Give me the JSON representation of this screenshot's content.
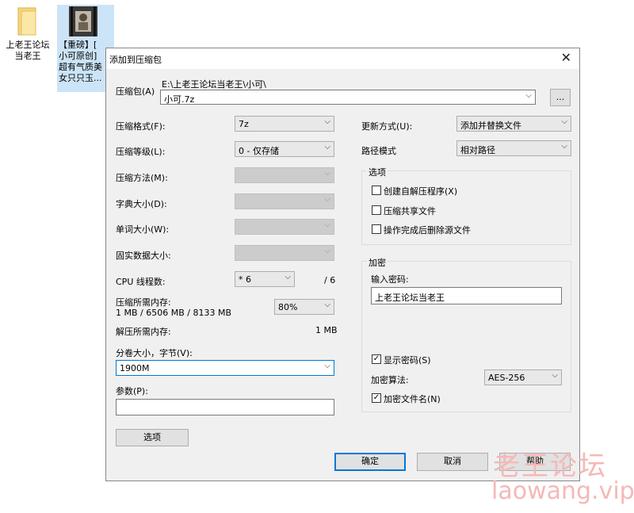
{
  "desktop": {
    "folder_label_line1": "上老王论坛",
    "folder_label_line2": "当老王",
    "file_label_line1": "【重磅】[",
    "file_label_line2": "小可原创]",
    "file_label_line3": "超有气质美",
    "file_label_line4": "女只只玉..."
  },
  "dialog": {
    "title": "添加到压缩包",
    "archive_label": "压缩包(A)",
    "archive_path": "E:\\上老王论坛当老王\\小可\\",
    "archive_name": "小可.7z",
    "browse_label": "...",
    "format_label": "压缩格式(F):",
    "format_value": "7z",
    "level_label": "压缩等级(L):",
    "level_value": "0 - 仅存储",
    "method_label": "压缩方法(M):",
    "dict_label": "字典大小(D):",
    "word_label": "单词大小(W):",
    "solid_label": "固实数据大小:",
    "cpu_label": "CPU 线程数:",
    "cpu_value": "* 6",
    "cpu_total": "/ 6",
    "mem_compress_label": "压缩所需内存:",
    "mem_compress_value": "1 MB / 6506 MB / 8133 MB",
    "mem_percent": "80%",
    "mem_decompress_label": "解压所需内存:",
    "mem_decompress_value": "1 MB",
    "volume_label": "分卷大小，字节(V):",
    "volume_value": "1900M",
    "params_label": "参数(P):",
    "params_value": "",
    "options_button": "选项",
    "update_label": "更新方式(U):",
    "update_value": "添加并替换文件",
    "path_mode_label": "路径模式",
    "path_mode_value": "相对路径",
    "options_group_title": "选项",
    "opt_sfx": "创建自解压程序(X)",
    "opt_shared": "压缩共享文件",
    "opt_delete": "操作完成后删除源文件",
    "encrypt_group_title": "加密",
    "password_label": "输入密码:",
    "password_value": "上老王论坛当老王",
    "show_password": "显示密码(S)",
    "enc_method_label": "加密算法:",
    "enc_method_value": "AES-256",
    "encrypt_names": "加密文件名(N)",
    "ok_button": "确定",
    "cancel_button": "取消",
    "help_button": "帮助"
  },
  "watermark": {
    "cn": "老王论坛",
    "url": "laowang.vip"
  },
  "colors": {
    "dialog_bg": "#f0f0f0",
    "accent": "#0078d7",
    "watermark": "#f4b8b8"
  }
}
